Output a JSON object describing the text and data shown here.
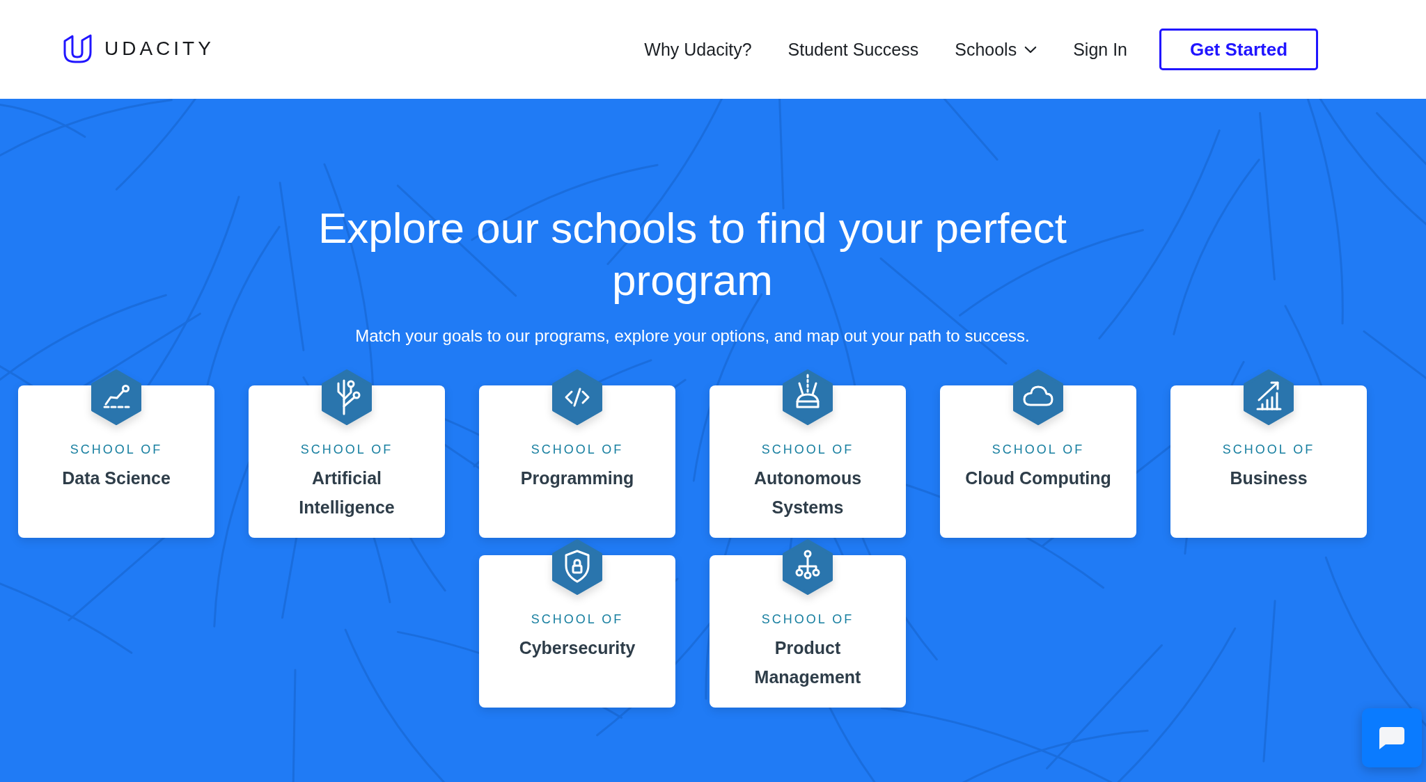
{
  "header": {
    "logo_text": "UDACITY",
    "nav": [
      {
        "label": "Why Udacity?",
        "kind": "link"
      },
      {
        "label": "Student Success",
        "kind": "link"
      },
      {
        "label": "Schools",
        "kind": "dropdown"
      },
      {
        "label": "Sign In",
        "kind": "link"
      }
    ],
    "cta": "Get Started"
  },
  "hero": {
    "title": "Explore our schools to find your perfect program",
    "subtitle": "Match your goals to our programs, explore your options, and map out your path to success.",
    "schools": [
      {
        "prefix": "SCHOOL OF",
        "name": "Data Science"
      },
      {
        "prefix": "SCHOOL OF",
        "name": "Artificial Intelligence"
      },
      {
        "prefix": "SCHOOL OF",
        "name": "Programming"
      },
      {
        "prefix": "SCHOOL OF",
        "name": "Autonomous Systems"
      },
      {
        "prefix": "SCHOOL OF",
        "name": "Cloud Computing"
      },
      {
        "prefix": "SCHOOL OF",
        "name": "Business"
      },
      {
        "prefix": "SCHOOL OF",
        "name": "Cybersecurity"
      },
      {
        "prefix": "SCHOOL OF",
        "name": "Product Management"
      }
    ]
  }
}
